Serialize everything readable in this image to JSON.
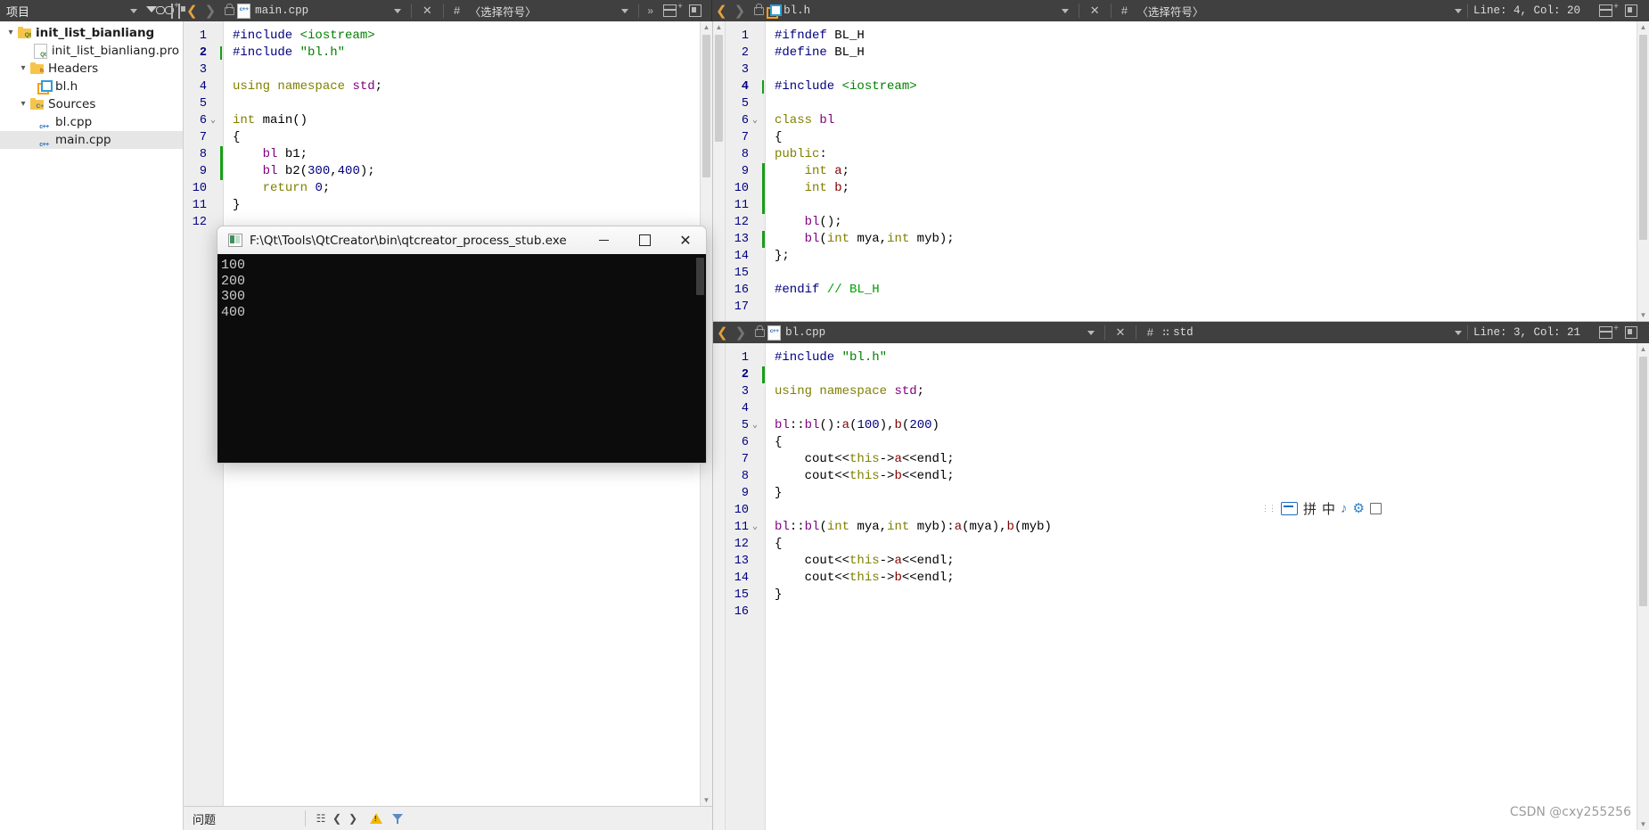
{
  "sidebar": {
    "header": {
      "title": "项目",
      "dropdown_icon": "chevron-down-icon",
      "filter_icon": "filter-icon",
      "link_icon": "link-icon",
      "split_icon": "split-add-icon",
      "close_icon": "close-panel-icon"
    },
    "tree": [
      {
        "label": "init_list_bianliang",
        "icon": "qt-project-folder-icon",
        "indent": 0,
        "expanded": true,
        "bold": true,
        "selected": false
      },
      {
        "label": "init_list_bianliang.pro",
        "icon": "qt-pro-file-icon",
        "indent": 1,
        "expanded": null,
        "bold": false,
        "selected": false
      },
      {
        "label": "Headers",
        "icon": "headers-folder-icon",
        "indent": 1,
        "expanded": true,
        "bold": false,
        "selected": false
      },
      {
        "label": "bl.h",
        "icon": "qt-header-file-icon",
        "indent": 2,
        "expanded": null,
        "bold": false,
        "selected": false
      },
      {
        "label": "Sources",
        "icon": "sources-folder-icon",
        "indent": 1,
        "expanded": true,
        "bold": false,
        "selected": false
      },
      {
        "label": "bl.cpp",
        "icon": "cpp-file-icon",
        "indent": 2,
        "expanded": null,
        "bold": false,
        "selected": false
      },
      {
        "label": "main.cpp",
        "icon": "cpp-file-icon",
        "indent": 2,
        "expanded": null,
        "bold": false,
        "selected": true
      }
    ]
  },
  "editor_main": {
    "filename": "main.cpp",
    "symbol_selector": "〈选择符号〉",
    "back_icon": "back-chevron-icon",
    "forward_icon": "forward-chevron-icon",
    "lock_icon": "unlocked-icon",
    "file_icon": "cpp-file-icon",
    "dropdown_icon": "chevron-down-icon",
    "close_icon": "close-icon",
    "hash_icon": "hash-icon",
    "more_icon": "more-chevron-icon",
    "split_icon": "split-add-icon",
    "unsplit_icon": "unsplit-icon",
    "lines": [
      {
        "n": 1,
        "current": false,
        "fold": "",
        "changed": false
      },
      {
        "n": 2,
        "current": true,
        "fold": "",
        "changed": false
      },
      {
        "n": 3,
        "current": false,
        "fold": "",
        "changed": false
      },
      {
        "n": 4,
        "current": false,
        "fold": "",
        "changed": false
      },
      {
        "n": 5,
        "current": false,
        "fold": "",
        "changed": false
      },
      {
        "n": 6,
        "current": false,
        "fold": "v",
        "changed": false
      },
      {
        "n": 7,
        "current": false,
        "fold": "",
        "changed": false
      },
      {
        "n": 8,
        "current": false,
        "fold": "",
        "changed": true
      },
      {
        "n": 9,
        "current": false,
        "fold": "",
        "changed": true
      },
      {
        "n": 10,
        "current": false,
        "fold": "",
        "changed": false
      },
      {
        "n": 11,
        "current": false,
        "fold": "",
        "changed": false
      },
      {
        "n": 12,
        "current": false,
        "fold": "",
        "changed": false
      }
    ],
    "code": [
      "#include <iostream>",
      "#include \"bl.h\"",
      "",
      "using namespace std;",
      "",
      "int main()",
      "{",
      "    bl b1;",
      "    bl b2(300,400);",
      "    return 0;",
      "}",
      ""
    ]
  },
  "editor_header": {
    "filename": "bl.h",
    "symbol_selector": "〈选择符号〉",
    "cursor_position": "Line: 4, Col: 20",
    "back_icon": "back-chevron-icon",
    "forward_icon": "forward-chevron-icon",
    "lock_icon": "unlocked-icon",
    "file_icon": "qt-header-file-icon",
    "dropdown_icon": "chevron-down-icon",
    "close_icon": "close-icon",
    "hash_icon": "hash-icon",
    "split_icon": "split-add-icon",
    "unsplit_icon": "unsplit-icon",
    "lines": [
      {
        "n": 1,
        "current": false,
        "fold": "",
        "changed": false
      },
      {
        "n": 2,
        "current": false,
        "fold": "",
        "changed": false
      },
      {
        "n": 3,
        "current": false,
        "fold": "",
        "changed": false
      },
      {
        "n": 4,
        "current": true,
        "fold": "",
        "changed": false
      },
      {
        "n": 5,
        "current": false,
        "fold": "",
        "changed": false
      },
      {
        "n": 6,
        "current": false,
        "fold": "v",
        "changed": false
      },
      {
        "n": 7,
        "current": false,
        "fold": "",
        "changed": false
      },
      {
        "n": 8,
        "current": false,
        "fold": "",
        "changed": false
      },
      {
        "n": 9,
        "current": false,
        "fold": "",
        "changed": true
      },
      {
        "n": 10,
        "current": false,
        "fold": "",
        "changed": true
      },
      {
        "n": 11,
        "current": false,
        "fold": "",
        "changed": true
      },
      {
        "n": 12,
        "current": false,
        "fold": "",
        "changed": false
      },
      {
        "n": 13,
        "current": false,
        "fold": "",
        "changed": true
      },
      {
        "n": 14,
        "current": false,
        "fold": "",
        "changed": false
      },
      {
        "n": 15,
        "current": false,
        "fold": "",
        "changed": false
      },
      {
        "n": 16,
        "current": false,
        "fold": "",
        "changed": false
      },
      {
        "n": 17,
        "current": false,
        "fold": "",
        "changed": false
      }
    ],
    "code": [
      "#ifndef BL_H",
      "#define BL_H",
      "",
      "#include <iostream>",
      "",
      "class bl",
      "{",
      "public:",
      "    int a;",
      "    int b;",
      "",
      "    bl();",
      "    bl(int mya,int myb);",
      "};",
      "",
      "#endif // BL_H",
      ""
    ]
  },
  "editor_source": {
    "filename": "bl.cpp",
    "symbol_selector": "std",
    "cursor_position": "Line: 3, Col: 21",
    "back_icon": "back-chevron-icon",
    "forward_icon": "forward-chevron-icon",
    "lock_icon": "unlocked-icon",
    "file_icon": "cpp-file-icon",
    "dropdown_icon": "chevron-down-icon",
    "close_icon": "close-icon",
    "hash_icon": "hash-icon",
    "namespace_icon": "namespace-icon",
    "split_icon": "split-add-icon",
    "unsplit_icon": "unsplit-icon",
    "lines": [
      {
        "n": 1,
        "current": false,
        "fold": "",
        "changed": false
      },
      {
        "n": 2,
        "current": true,
        "fold": "",
        "changed": true
      },
      {
        "n": 3,
        "current": false,
        "fold": "",
        "changed": false
      },
      {
        "n": 4,
        "current": false,
        "fold": "",
        "changed": false
      },
      {
        "n": 5,
        "current": false,
        "fold": "v",
        "changed": false
      },
      {
        "n": 6,
        "current": false,
        "fold": "",
        "changed": false
      },
      {
        "n": 7,
        "current": false,
        "fold": "",
        "changed": false
      },
      {
        "n": 8,
        "current": false,
        "fold": "",
        "changed": false
      },
      {
        "n": 9,
        "current": false,
        "fold": "",
        "changed": false
      },
      {
        "n": 10,
        "current": false,
        "fold": "",
        "changed": false
      },
      {
        "n": 11,
        "current": false,
        "fold": "v",
        "changed": false
      },
      {
        "n": 12,
        "current": false,
        "fold": "",
        "changed": false
      },
      {
        "n": 13,
        "current": false,
        "fold": "",
        "changed": false
      },
      {
        "n": 14,
        "current": false,
        "fold": "",
        "changed": false
      },
      {
        "n": 15,
        "current": false,
        "fold": "",
        "changed": false
      },
      {
        "n": 16,
        "current": false,
        "fold": "",
        "changed": false
      }
    ],
    "code": [
      "#include \"bl.h\"",
      "",
      "using namespace std;",
      "",
      "bl::bl():a(100),b(200)",
      "{",
      "    cout<<this->a<<endl;",
      "    cout<<this->b<<endl;",
      "}",
      "",
      "bl::bl(int mya,int myb):a(mya),b(myb)",
      "{",
      "    cout<<this->a<<endl;",
      "    cout<<this->b<<endl;",
      "}",
      ""
    ]
  },
  "console_window": {
    "title": "F:\\Qt\\Tools\\QtCreator\\bin\\qtcreator_process_stub.exe",
    "app_icon": "console-app-icon",
    "minimize_label": "minimize-icon",
    "maximize_label": "maximize-icon",
    "close_label": "close-icon",
    "output": [
      "100",
      "200",
      "300",
      "400"
    ]
  },
  "status_bar": {
    "issues_label": "问题",
    "search_icon": "search-results-icon",
    "prev_icon": "previous-item-icon",
    "next_icon": "next-item-icon",
    "warning_icon": "warning-icon",
    "filter_icon": "filter-icon"
  },
  "ime_toolbar": {
    "grip_icon": "drag-grip-icon",
    "keyboard_icon": "soft-keyboard-icon",
    "pinyin_label": "拼",
    "mode_label": "中",
    "tools_icon": "music-note-icon",
    "settings_icon": "gear-icon",
    "expand_icon": "expand-icon"
  },
  "watermark": {
    "text": "CSDN @cxy255256"
  },
  "colors": {
    "toolbar_bg": "#404040",
    "gutter_bg": "#eeeeee",
    "editor_bg": "#ffffff",
    "selection_bg": "#e6e6e6",
    "preprocessor": "#000080",
    "string": "#008000",
    "comment": "#00a000",
    "keyword": "#808000",
    "type": "#800080",
    "member": "#800000",
    "caret_green": "#12a012",
    "qt_orange": "#f5a01a",
    "qt_blue": "#2a9fd6"
  }
}
